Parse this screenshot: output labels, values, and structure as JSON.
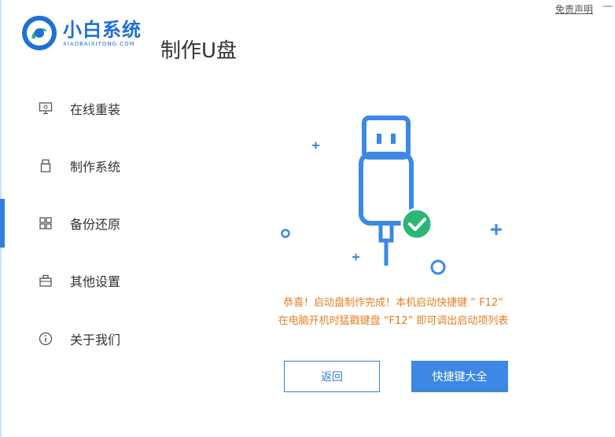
{
  "header": {
    "brand_name": "小白系统",
    "brand_sub": "XIAOBAIXITONG.COM",
    "page_title": "制作U盘",
    "disclaimer": "免责声明",
    "minimize": "—"
  },
  "sidebar": {
    "active_index": 2,
    "items": [
      {
        "label": "在线重装",
        "icon": "monitor-icon"
      },
      {
        "label": "制作系统",
        "icon": "usb-drive-icon"
      },
      {
        "label": "备份还原",
        "icon": "grid-icon"
      },
      {
        "label": "其他设置",
        "icon": "toolbox-icon"
      },
      {
        "label": "关于我们",
        "icon": "info-icon"
      }
    ]
  },
  "main": {
    "message_line1": "恭喜！启动盘制作完成！本机启动快捷键 “ F12”",
    "message_line2": "在电脑开机时猛戳键盘 “F12” 即可调出启动项列表",
    "back_button": "返回",
    "hotkeys_button": "快捷键大全"
  },
  "colors": {
    "accent": "#2f7ee0",
    "success": "#2bb673",
    "message": "#e67e22"
  }
}
